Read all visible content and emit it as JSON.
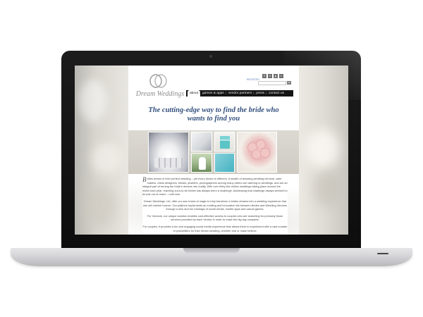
{
  "site": {
    "logo_text": "Dream Weddings",
    "register_link": "REGISTER",
    "social_icons": [
      "facebook-icon",
      "twitter-icon",
      "pinterest-icon",
      "rss-icon"
    ],
    "social_glyphs": [
      "f",
      "t",
      "p",
      "r"
    ],
    "search": {
      "placeholder": "",
      "button_label": "GO"
    },
    "nav": [
      {
        "label": "about",
        "active": true
      },
      {
        "label": "games & apps",
        "active": false
      },
      {
        "label": "vendor partners",
        "active": false
      },
      {
        "label": "press",
        "active": false
      },
      {
        "label": "contact us",
        "active": false
      }
    ],
    "headline_line1": "The cutting-edge way to find the bride who",
    "headline_line2": "wants to find you",
    "paragraphs": [
      {
        "dropcap": "B",
        "text": "rides dream of their perfect wedding – yet every dream is different. A wealth of amazing wedding vendors: cake makers, dress designers, florists, jewelers, photographers among many others are catering to weddings, and are an integral part of turning the bride's dreams into reality. With over thirty-five million weddings taking place around the world each year, reaching soon-to-be brides has always been a challenge. Addressing that challenge always seemed to be just out of reach – until now."
      },
      {
        "text": "Dream Weddings, Ltd. offer our own brand of magic to help transform a brides dreams into a wedding experience that she will cherish forever. Our platform implements an exciting and innovative link between Brides and Wedding Vendors through a new and fun marriage of social media, mobile apps and casual games."
      },
      {
        "text": "For Vendors, our unique solution enables cost-effective access to couples who are searching for precisely those services provided by each Vendor in order to make the big day complete."
      },
      {
        "text": "For couples, it provides a fun and engaging social media experience that allows them to experiment with a vast number of possibilities for their dream wedding, whether real or make believe."
      }
    ]
  },
  "colors": {
    "headline": "#33507e",
    "nav_bg": "#151515",
    "link": "#5b7fb8"
  }
}
